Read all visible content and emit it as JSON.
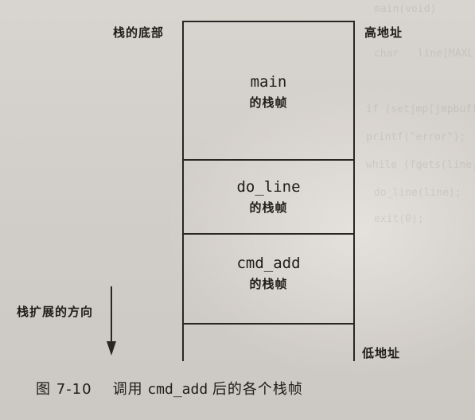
{
  "diagram": {
    "stack_bottom_label": "栈的底部",
    "high_address_label": "高地址",
    "low_address_label": "低地址",
    "growth_direction_label": "栈扩展的方向",
    "frames": [
      {
        "function": "main",
        "sub": "的栈帧"
      },
      {
        "function": "do_line",
        "sub": "的栈帧"
      },
      {
        "function": "cmd_add",
        "sub": "的栈帧"
      }
    ]
  },
  "caption": {
    "number": "图 7-10",
    "text_before": "调用",
    "code": "cmd_add",
    "text_after": "后的各个栈帧"
  },
  "colors": {
    "ink": "#1f1c19",
    "paper": "#d4d0cb"
  }
}
